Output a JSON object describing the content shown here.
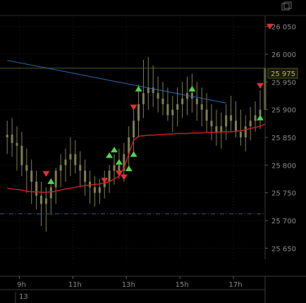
{
  "window": {
    "restore_icon": "restore-window-icon"
  },
  "colors": {
    "background": "#000000",
    "grid": "#1f1f1f",
    "candle": "#7f7f4c",
    "last_price_line": "#4d5a1f",
    "trend_line": "#2c6bb0",
    "moving_average": "#c91f1f",
    "support_line": "#2b5c8a",
    "buy_marker": "#4fd44f",
    "sell_marker": "#e03030"
  },
  "chart_data": {
    "type": "candlestick",
    "ylim": [
      25630,
      26070
    ],
    "y_ticks": [
      26050,
      26000,
      25950,
      25900,
      25850,
      25800,
      25750,
      25700,
      25650
    ],
    "y_tick_labels": [
      "26 050",
      "26 000",
      "25 950",
      "25 900",
      "25 850",
      "25 800",
      "25 750",
      "25 700",
      "25 650"
    ],
    "x_ticks": [
      {
        "label": "9h",
        "pos": 0.5
      },
      {
        "label": "11h",
        "pos": 11.5
      },
      {
        "label": "13h",
        "pos": 22.5
      },
      {
        "label": "15h",
        "pos": 33.5
      },
      {
        "label": "17h",
        "pos": 44.5
      }
    ],
    "date_label": "13",
    "last_price": 25975,
    "last_price_label": "25 975",
    "support_level": 25712,
    "trend_line": [
      [
        -2,
        25989
      ],
      [
        43,
        25912
      ]
    ],
    "x": [
      -2,
      -1,
      0,
      1,
      2,
      3,
      4,
      5,
      6,
      7,
      8,
      9,
      10,
      11,
      12,
      13,
      14,
      15,
      16,
      17,
      18,
      19,
      20,
      21,
      22,
      23,
      24,
      25,
      26,
      27,
      28,
      29,
      30,
      31,
      32,
      33,
      34,
      35,
      36,
      37,
      38,
      39,
      40,
      41,
      42,
      43,
      44,
      45,
      46,
      47,
      48,
      49,
      50,
      51
    ],
    "open": [
      25850,
      25855,
      25840,
      25835,
      25800,
      25790,
      25770,
      25745,
      25730,
      25740,
      25760,
      25790,
      25800,
      25810,
      25820,
      25800,
      25790,
      25770,
      25760,
      25750,
      25760,
      25770,
      25790,
      25800,
      25790,
      25820,
      25850,
      25880,
      25910,
      25930,
      25940,
      25930,
      25920,
      25910,
      25890,
      25900,
      25910,
      25920,
      25930,
      25920,
      25910,
      25900,
      25880,
      25870,
      25860,
      25870,
      25890,
      25880,
      25860,
      25850,
      25870,
      25880,
      25890,
      25900
    ],
    "high": [
      25880,
      25885,
      25870,
      25860,
      25830,
      25810,
      25790,
      25770,
      25760,
      25775,
      25795,
      25820,
      25830,
      25850,
      25845,
      25825,
      25810,
      25790,
      25780,
      25775,
      25790,
      25800,
      25820,
      25830,
      25840,
      25870,
      25900,
      25945,
      25990,
      25995,
      25980,
      25960,
      25950,
      25940,
      25925,
      25940,
      25950,
      25960,
      25965,
      25950,
      25940,
      25930,
      25910,
      25900,
      25895,
      25910,
      25925,
      25915,
      25900,
      25890,
      25905,
      25915,
      25935,
      25980
    ],
    "low": [
      25820,
      25815,
      25790,
      25780,
      25750,
      25730,
      25720,
      25690,
      25680,
      25710,
      25730,
      25760,
      25770,
      25780,
      25785,
      25760,
      25745,
      25730,
      25725,
      25730,
      25740,
      25750,
      25765,
      25775,
      25770,
      25795,
      25820,
      25850,
      25885,
      25900,
      25905,
      25895,
      25890,
      25880,
      25860,
      25870,
      25885,
      25890,
      25895,
      25880,
      25870,
      25860,
      25845,
      25835,
      25830,
      25845,
      25860,
      25850,
      25835,
      25825,
      25845,
      25860,
      25865,
      25880
    ],
    "close": [
      25855,
      25840,
      25835,
      25800,
      25790,
      25770,
      25745,
      25730,
      25740,
      25760,
      25790,
      25800,
      25810,
      25820,
      25800,
      25790,
      25770,
      25760,
      25750,
      25760,
      25770,
      25790,
      25800,
      25790,
      25820,
      25850,
      25880,
      25910,
      25930,
      25940,
      25930,
      25920,
      25910,
      25890,
      25900,
      25910,
      25920,
      25930,
      25920,
      25910,
      25900,
      25880,
      25870,
      25860,
      25870,
      25890,
      25880,
      25860,
      25850,
      25870,
      25880,
      25890,
      25900,
      25975
    ],
    "moving_average": [
      25758,
      25757,
      25756,
      25755,
      25753,
      25752,
      25752,
      25751,
      25751,
      25752,
      25753,
      25755,
      25757,
      25758,
      25760,
      25762,
      25763,
      25764,
      25765,
      25766,
      25768,
      25770,
      25775,
      25780,
      25795,
      25820,
      25845,
      25852,
      25853,
      25854,
      25854,
      25855,
      25855,
      25856,
      25856,
      25857,
      25857,
      25857,
      25858,
      25858,
      25858,
      25859,
      25859,
      25859,
      25860,
      25860,
      25860,
      25861,
      25862,
      25864,
      25866,
      25868,
      25870,
      25874
    ],
    "buy_signals": [
      {
        "x": 7,
        "y": 25771
      },
      {
        "x": 19,
        "y": 25818
      },
      {
        "x": 20,
        "y": 25828
      },
      {
        "x": 21,
        "y": 25806
      },
      {
        "x": 23,
        "y": 25794
      },
      {
        "x": 24,
        "y": 25820
      },
      {
        "x": 25,
        "y": 25938
      },
      {
        "x": 36,
        "y": 25938
      },
      {
        "x": 50,
        "y": 25886
      }
    ],
    "sell_signals": [
      {
        "x": 6,
        "y": 25784
      },
      {
        "x": 18,
        "y": 25772
      },
      {
        "x": 21,
        "y": 25785
      },
      {
        "x": 22,
        "y": 25778
      },
      {
        "x": 24,
        "y": 25904
      },
      {
        "x": 50,
        "y": 25943
      },
      {
        "x": 52,
        "y": 26050
      }
    ]
  }
}
